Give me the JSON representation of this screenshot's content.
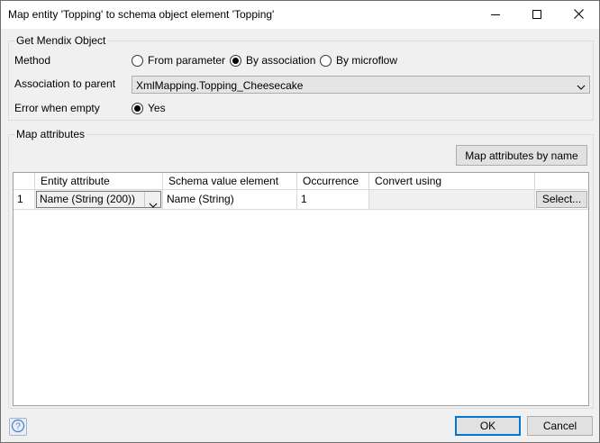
{
  "window": {
    "title": "Map entity 'Topping' to schema object element 'Topping'",
    "controls": {
      "minimize": "minimize-icon",
      "maximize": "maximize-icon",
      "close": "close-icon"
    }
  },
  "get_object": {
    "legend": "Get Mendix Object",
    "method_label": "Method",
    "method_options": [
      {
        "label": "From parameter",
        "selected": false
      },
      {
        "label": "By association",
        "selected": true
      },
      {
        "label": "By microflow",
        "selected": false
      }
    ],
    "association_label": "Association to parent",
    "association_value": "XmlMapping.Topping_Cheesecake",
    "error_label": "Error when empty",
    "error_option": {
      "label": "Yes",
      "selected": true
    }
  },
  "map_attributes": {
    "legend": "Map attributes",
    "by_name_button": "Map attributes by name",
    "columns": [
      "Entity attribute",
      "Schema value element",
      "Occurrence",
      "Convert using"
    ],
    "rows": [
      {
        "index": "1",
        "entity_attribute": "Name (String (200))",
        "schema_value_element": "Name (String)",
        "occurrence": "1",
        "convert_using": "",
        "select_button": "Select..."
      }
    ]
  },
  "footer": {
    "help_icon": "help-icon",
    "ok_button": "OK",
    "cancel_button": "Cancel"
  },
  "colors": {
    "accent": "#0078d7",
    "help_blue": "#4a7fbf"
  }
}
